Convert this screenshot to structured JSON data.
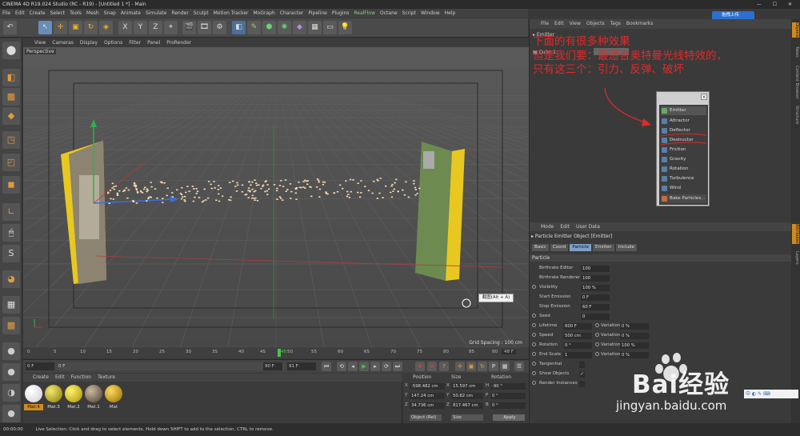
{
  "window": {
    "title": "CINEMA 4D R19.024 Studio (RC - R19) - [Untitled 1 *] - Main"
  },
  "upload_button": "拖拽上传",
  "menu": [
    "File",
    "Edit",
    "Create",
    "Select",
    "Tools",
    "Mesh",
    "Snap",
    "Animate",
    "Simulate",
    "Render",
    "Sculpt",
    "Motion Tracker",
    "MoGraph",
    "Character",
    "Pipeline",
    "Plugins",
    "RealFlow",
    "Octane",
    "Script",
    "Window",
    "Help"
  ],
  "viewport_menu": [
    "View",
    "Cameras",
    "Display",
    "Options",
    "Filter",
    "Panel",
    "ProRender"
  ],
  "viewport": {
    "label": "Perspective",
    "grid_spacing": "Grid Spacing : 100 cm",
    "screenshot_tip": "截图(Alt + A)"
  },
  "timeline": {
    "ticks": [
      "0",
      "5",
      "10",
      "15",
      "20",
      "25",
      "30",
      "35",
      "40",
      "45",
      "50",
      "55",
      "60",
      "65",
      "70",
      "75",
      "80",
      "85",
      "90"
    ],
    "current_frame": "48",
    "end_field": "48 F"
  },
  "transport": {
    "start": "0 F",
    "start2": "0 F",
    "mid": "90 F",
    "end": "91 F"
  },
  "materials": {
    "menu": [
      "Create",
      "Edit",
      "Function",
      "Texture"
    ],
    "items": [
      {
        "label": "Mat.4",
        "color": "#f4f4f4"
      },
      {
        "label": "Mat.3",
        "color": "#c8b800"
      },
      {
        "label": "Mat.2",
        "color": "#e0c800"
      },
      {
        "label": "Mat.1",
        "color": "#8a7860"
      },
      {
        "label": "Mat",
        "color": "#d8a800"
      }
    ]
  },
  "coords": {
    "headers": [
      "Position",
      "Size",
      "Rotation"
    ],
    "rows": [
      {
        "axis": "X",
        "pos": "-598.482 cm",
        "size_axis": "X",
        "size": "15.597 cm",
        "rot_axis": "H",
        "rot": "-90 °"
      },
      {
        "axis": "Y",
        "pos": "147.24 cm",
        "size_axis": "Y",
        "size": "50.82 cm",
        "rot_axis": "P",
        "rot": "0 °"
      },
      {
        "axis": "Z",
        "pos": "34.736 cm",
        "size_axis": "Z",
        "size": "817.467 cm",
        "rot_axis": "B",
        "rot": "0 °"
      }
    ],
    "mode": "Object (Rel)",
    "size_mode": "Size",
    "apply": "Apply"
  },
  "status": {
    "time": "00:00:00",
    "text": "Live Selection: Click and drag to select elements. Hold down SHIFT to add to the selection, CTRL to remove."
  },
  "object_manager": {
    "menu": [
      "File",
      "Edit",
      "View",
      "Objects",
      "Tags",
      "Bookmarks"
    ],
    "objects": [
      "Emitter",
      "Cube.1"
    ]
  },
  "annotation": {
    "lines": [
      "下面的有很多种效果",
      "但是我们要：最适合奥特曼光线特效的，",
      "只有这三个：引力、反弹、破坏"
    ]
  },
  "particle_menu": {
    "header": "Emitter",
    "items": [
      "Attractor",
      "Deflector",
      "Destructor",
      "Friction",
      "Gravity",
      "Rotation",
      "Turbulence",
      "Wind"
    ],
    "bake": "Bake Particles..."
  },
  "attributes": {
    "menu": [
      "Mode",
      "Edit",
      "User Data"
    ],
    "title": "Particle Emitter Object [Emitter]",
    "tabs": [
      "Basic",
      "Coord",
      "Particle",
      "Emitter",
      "Include"
    ],
    "active_tab": "Particle",
    "section": "Particle",
    "rows": [
      {
        "label": "Birthrate Editor",
        "value": "100"
      },
      {
        "label": "Birthrate Renderer",
        "value": "100"
      },
      {
        "label": "Visibility",
        "value": "100 %"
      },
      {
        "label": "Start Emission",
        "value": "0 F"
      },
      {
        "label": "Stop Emission",
        "value": "60 F"
      },
      {
        "label": "Seed",
        "value": "0"
      }
    ],
    "pairs": [
      {
        "label": "Lifetime",
        "value": "600 F",
        "vlabel": "Variation",
        "vvalue": "0 %"
      },
      {
        "label": "Speed",
        "value": "500 cm",
        "vlabel": "Variation",
        "vvalue": "0 %"
      },
      {
        "label": "Rotation",
        "value": "0 °",
        "vlabel": "Variation",
        "vvalue": "100 %"
      },
      {
        "label": "End Scale",
        "value": "1",
        "vlabel": "Variation",
        "vvalue": "0 %"
      }
    ],
    "checks": [
      "Tangential",
      "Show Objects",
      "Render Instances"
    ]
  },
  "right_tabs": [
    "Objects",
    "Takes",
    "Content Browser",
    "Structure",
    "Attributes",
    "Layers"
  ],
  "watermark": {
    "brand": "Bai经验",
    "url": "jingyan.baidu.com"
  },
  "ime": "中 ◐ ✎ ⌨"
}
